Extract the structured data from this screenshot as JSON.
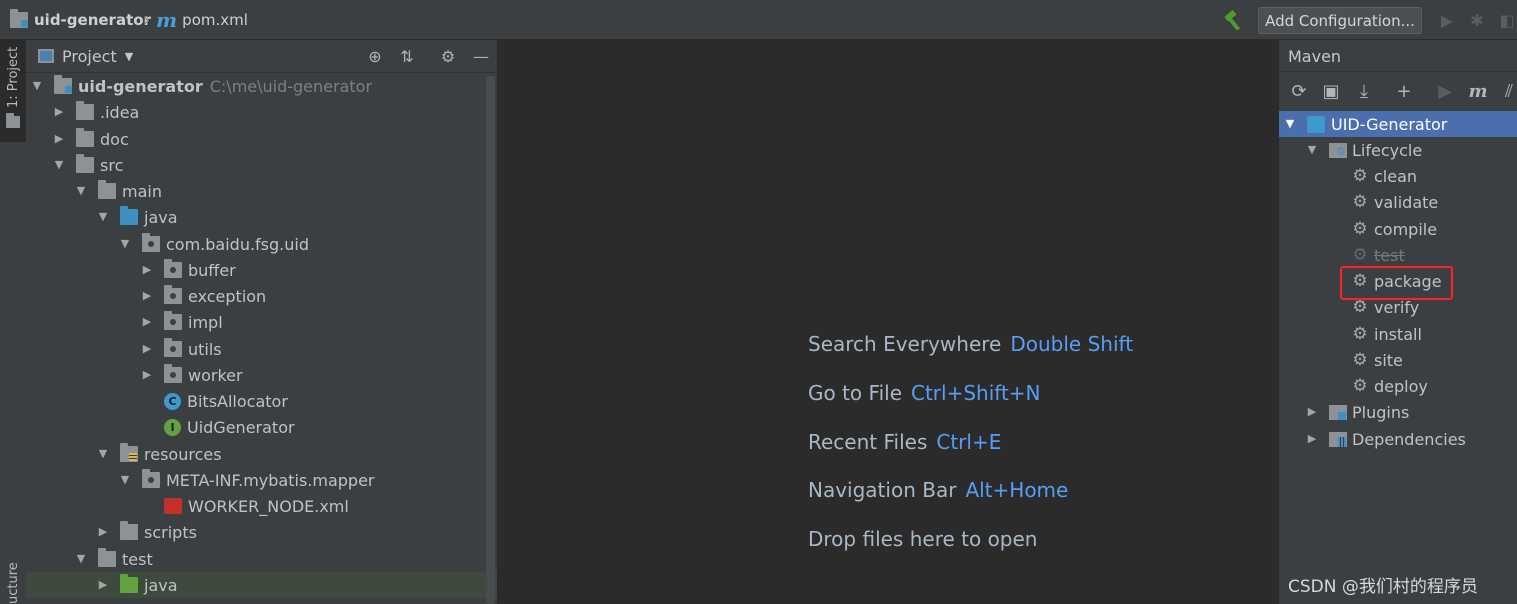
{
  "breadcrumb": {
    "project": "uid-generator",
    "file_icon": "m",
    "file": "pom.xml"
  },
  "toolbar": {
    "add_configuration": "Add Configuration..."
  },
  "left_strip": {
    "project_tab": "1: Project",
    "structure_tab": "ucture"
  },
  "project_panel": {
    "title": "Project",
    "tree": [
      {
        "label": "uid-generator",
        "path": "C:\\me\\uid-generator"
      },
      {
        "label": ".idea"
      },
      {
        "label": "doc"
      },
      {
        "label": "src"
      },
      {
        "label": "main"
      },
      {
        "label": "java"
      },
      {
        "label": "com.baidu.fsg.uid"
      },
      {
        "label": "buffer"
      },
      {
        "label": "exception"
      },
      {
        "label": "impl"
      },
      {
        "label": "utils"
      },
      {
        "label": "worker"
      },
      {
        "label": "BitsAllocator",
        "badge": "C"
      },
      {
        "label": "UidGenerator",
        "badge": "I"
      },
      {
        "label": "resources"
      },
      {
        "label": "META-INF.mybatis.mapper"
      },
      {
        "label": "WORKER_NODE.xml"
      },
      {
        "label": "scripts"
      },
      {
        "label": "test"
      },
      {
        "label": "java"
      }
    ]
  },
  "editor": {
    "hints": [
      {
        "label": "Search Everywhere",
        "key": "Double Shift"
      },
      {
        "label": "Go to File",
        "key": "Ctrl+Shift+N"
      },
      {
        "label": "Recent Files",
        "key": "Ctrl+E"
      },
      {
        "label": "Navigation Bar",
        "key": "Alt+Home"
      },
      {
        "label": "Drop files here to open",
        "key": ""
      }
    ]
  },
  "maven_panel": {
    "title": "Maven",
    "toolbar_m": "m",
    "tree": [
      {
        "label": "UID-Generator"
      },
      {
        "label": "Lifecycle"
      },
      {
        "label": "clean"
      },
      {
        "label": "validate"
      },
      {
        "label": "compile"
      },
      {
        "label": "test"
      },
      {
        "label": "package"
      },
      {
        "label": "verify"
      },
      {
        "label": "install"
      },
      {
        "label": "site"
      },
      {
        "label": "deploy"
      },
      {
        "label": "Plugins"
      },
      {
        "label": "Dependencies"
      }
    ]
  },
  "watermark": "CSDN @我们村的程序员",
  "colors": {
    "accent_blue": "#589df6",
    "selection": "#4b6eaf",
    "highlight_box": "#ff2020",
    "build_hammer": "#4e9a2e"
  }
}
